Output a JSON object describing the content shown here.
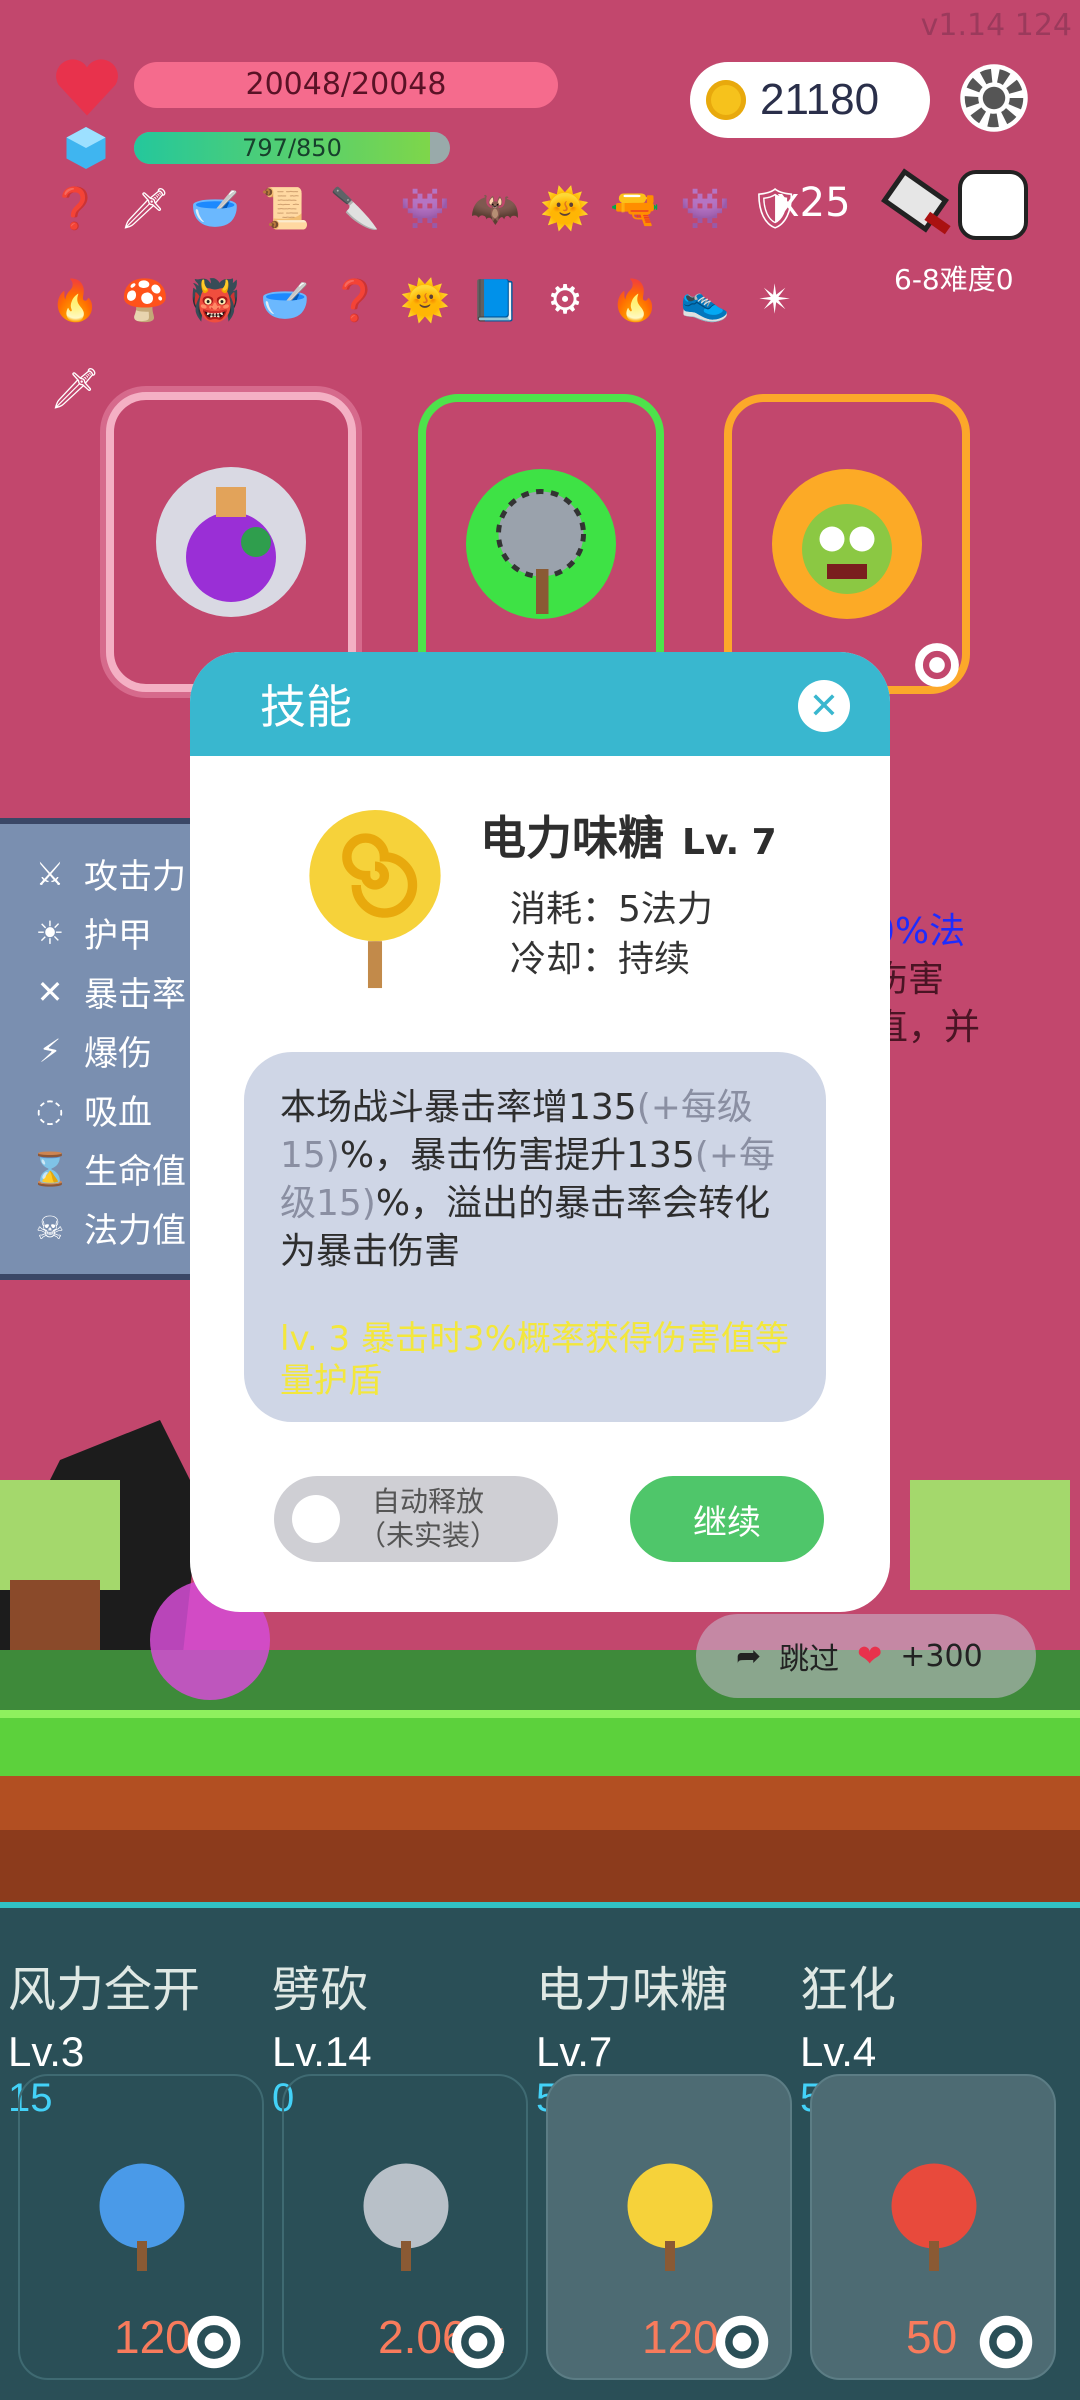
{
  "version": "v1.14 124",
  "player": {
    "hp": "20048/20048",
    "mp": "797/850",
    "mp_fraction": 0.9377
  },
  "gold": "21180",
  "items_row1": [
    "❓",
    "🗡",
    "🥣",
    "📜",
    "🔪",
    "👾",
    "🦇",
    "🌞",
    "🔫",
    "👾",
    "🛡"
  ],
  "items_row2": [
    "🔥",
    "🍄",
    "👹",
    "🥣",
    "❓",
    "🌞",
    "📘",
    "⚙",
    "🔥",
    "👟",
    "✴"
  ],
  "items_row3": [
    "🗡"
  ],
  "shield_count": "x25",
  "difficulty": "6-8难度0",
  "stats": [
    {
      "icon": "axe-icon",
      "glyph": "⚔",
      "label": "攻击力"
    },
    {
      "icon": "sun-icon",
      "glyph": "☀",
      "label": "护甲"
    },
    {
      "icon": "crit-icon",
      "glyph": "✕",
      "label": "暴击率"
    },
    {
      "icon": "bolt-icon",
      "glyph": "⚡",
      "label": "爆伤"
    },
    {
      "icon": "ring-icon",
      "glyph": "◌",
      "label": "吸血"
    },
    {
      "icon": "hourglass-icon",
      "glyph": "⌛",
      "label": "生命值"
    },
    {
      "icon": "skull-icon",
      "glyph": "☠",
      "label": "法力值"
    }
  ],
  "partial_text": [
    "0%法",
    "伤害",
    "直，并"
  ],
  "skip": {
    "label": "跳过",
    "bonus": "+300"
  },
  "modal": {
    "title": "技能",
    "skill_name": "电力味糖",
    "skill_level": "Lv. 7",
    "cost": "消耗：5法力",
    "cooldown": "冷却：持续",
    "desc_p1": "本场战斗暴击率增135",
    "desc_m1": "(+每级15)",
    "desc_p2": "%，暴击伤害提升135",
    "desc_m2": "(+每级15)",
    "desc_p3": "%，溢出的暴击率会转化为暴击伤害",
    "desc_bonus": "lv. 3  暴击时3%概率获得伤害值等量护盾",
    "auto_cast": "自动释放",
    "auto_note": "（未实装）",
    "continue": "继续"
  },
  "skills": [
    {
      "name": "风力全开",
      "lv": "Lv.3",
      "cost": "15",
      "price": "120"
    },
    {
      "name": "劈砍",
      "lv": "Lv.14",
      "cost": "0",
      "price": "2.06 k"
    },
    {
      "name": "电力味糖",
      "lv": "Lv.7",
      "cost": "5",
      "price": "120"
    },
    {
      "name": "狂化",
      "lv": "Lv.4",
      "cost": "5",
      "price": "50"
    }
  ]
}
